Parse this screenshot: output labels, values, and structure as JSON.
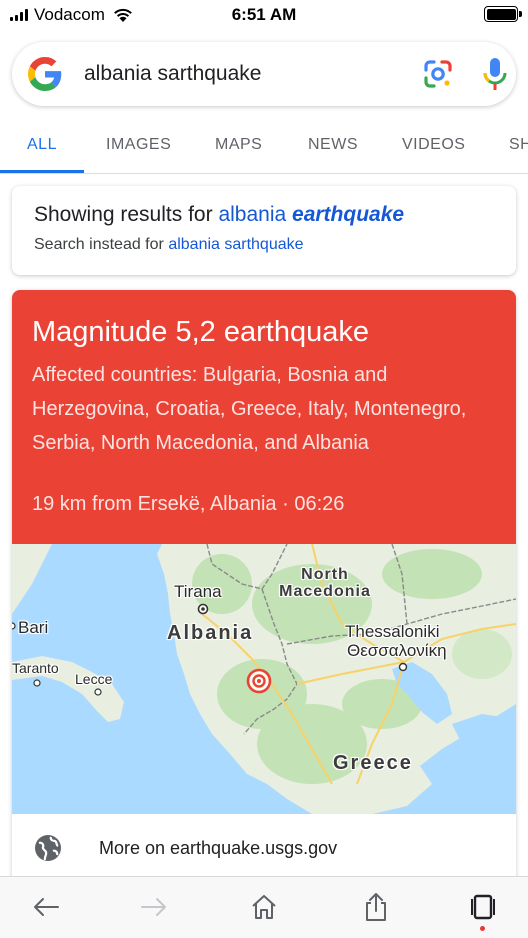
{
  "status_bar": {
    "carrier": "Vodacom",
    "time": "6:51 AM"
  },
  "search": {
    "query": "albania sarthquake"
  },
  "tabs": [
    {
      "label": "ALL",
      "active": true
    },
    {
      "label": "IMAGES",
      "active": false
    },
    {
      "label": "MAPS",
      "active": false
    },
    {
      "label": "NEWS",
      "active": false
    },
    {
      "label": "VIDEOS",
      "active": false
    },
    {
      "label": "SH",
      "active": false
    }
  ],
  "correction": {
    "showing_prefix": "Showing results for",
    "corrected_plain": "albania",
    "corrected_emphasis": "earthquake",
    "instead_prefix": "Search instead for",
    "instead_query": "albania sarthquake"
  },
  "earthquake": {
    "title": "Magnitude 5,2 earthquake",
    "affected": "Affected countries: Bulgaria, Bosnia and Herzegovina, Croatia, Greece, Italy, Montenegro, Serbia, North Macedonia, and Albania",
    "location": "19 km from Ersekë, Albania · 06:26",
    "accent_color": "#ea4335"
  },
  "map": {
    "labels": {
      "tirana": "Tirana",
      "north": "North",
      "macedonia": "Macedonia",
      "bari": "Bari",
      "albania": "Albania",
      "thessaloniki": "Thessaloniki",
      "thessaloniki_greek": "Θεσσαλονίκη",
      "taranto": "Taranto",
      "lecce": "Lecce",
      "greece": "Greece"
    }
  },
  "more": {
    "text": "More on earthquake.usgs.gov"
  },
  "icons": {
    "lens": "google-lens-icon",
    "mic": "microphone-icon",
    "globe": "globe-icon",
    "back": "back-arrow-icon",
    "forward": "forward-arrow-icon",
    "home": "home-icon",
    "share": "share-icon",
    "tabs": "tabs-icon"
  }
}
